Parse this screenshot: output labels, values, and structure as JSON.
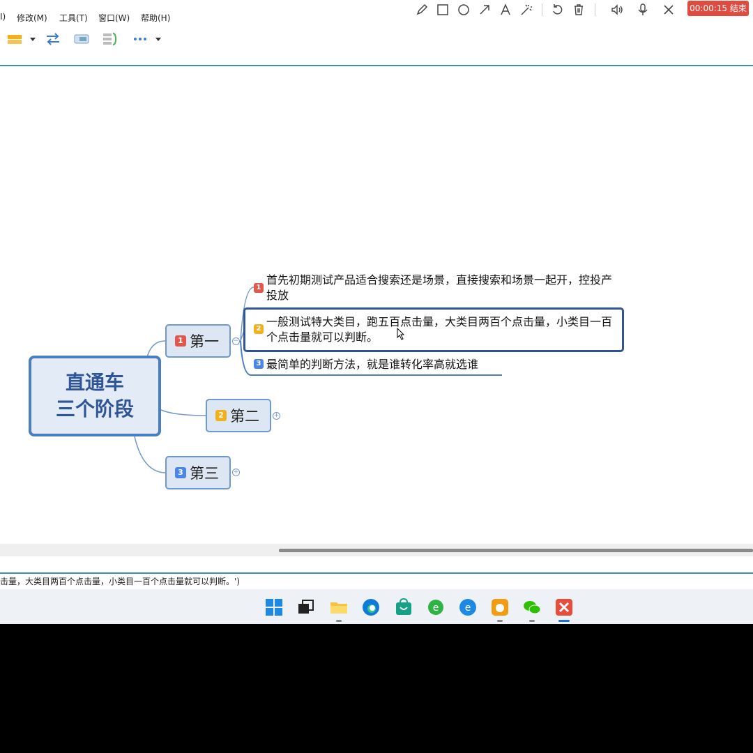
{
  "menubar": {
    "items": [
      "I)",
      "修改(M)",
      "工具(T)",
      "窗口(W)",
      "帮助(H)"
    ]
  },
  "recorder": {
    "tools": [
      "pencil-icon",
      "rectangle-icon",
      "circle-icon",
      "arrow-icon",
      "text-icon",
      "magic-wand-icon",
      "undo-icon",
      "trash-icon",
      "speaker-icon",
      "microphone-icon",
      "close-icon"
    ],
    "timer": "00:00:15 结束"
  },
  "mindmap": {
    "central": {
      "line1": "直通车",
      "line2": "三个阶段"
    },
    "topics": [
      {
        "badge": "1",
        "label": "第一"
      },
      {
        "badge": "2",
        "label": "第二"
      },
      {
        "badge": "3",
        "label": "第三"
      }
    ],
    "subtopics": [
      {
        "badge": "1",
        "text": "首先初期测试产品适合搜索还是场景，直接搜索和场景一起开，控投产投放"
      },
      {
        "badge": "2",
        "text": "一般测试特大类目，跑五百点击量，大类目两百个点击量，小类目一百个点击量就可以判断。"
      },
      {
        "badge": "3",
        "text": "最简单的判断方法，就是谁转化率高就选谁"
      }
    ]
  },
  "status": {
    "text": "击量，大类目两百个点击量，小类目一百个点击量就可以判断。')"
  },
  "taskbar": {
    "apps": [
      "windows-start-icon",
      "task-view-icon",
      "file-explorer-icon",
      "edge-icon",
      "store-icon",
      "ie-icon",
      "edge-legacy-icon",
      "uc-browser-icon",
      "wechat-icon",
      "xmind-icon"
    ]
  },
  "colors": {
    "accent": "#3a8fb7",
    "central_border": "#4a7dc4",
    "badge1": "#e2574c",
    "badge2": "#f2b01e",
    "badge3": "#4a86e8",
    "timer_bg": "#e04b3f"
  }
}
